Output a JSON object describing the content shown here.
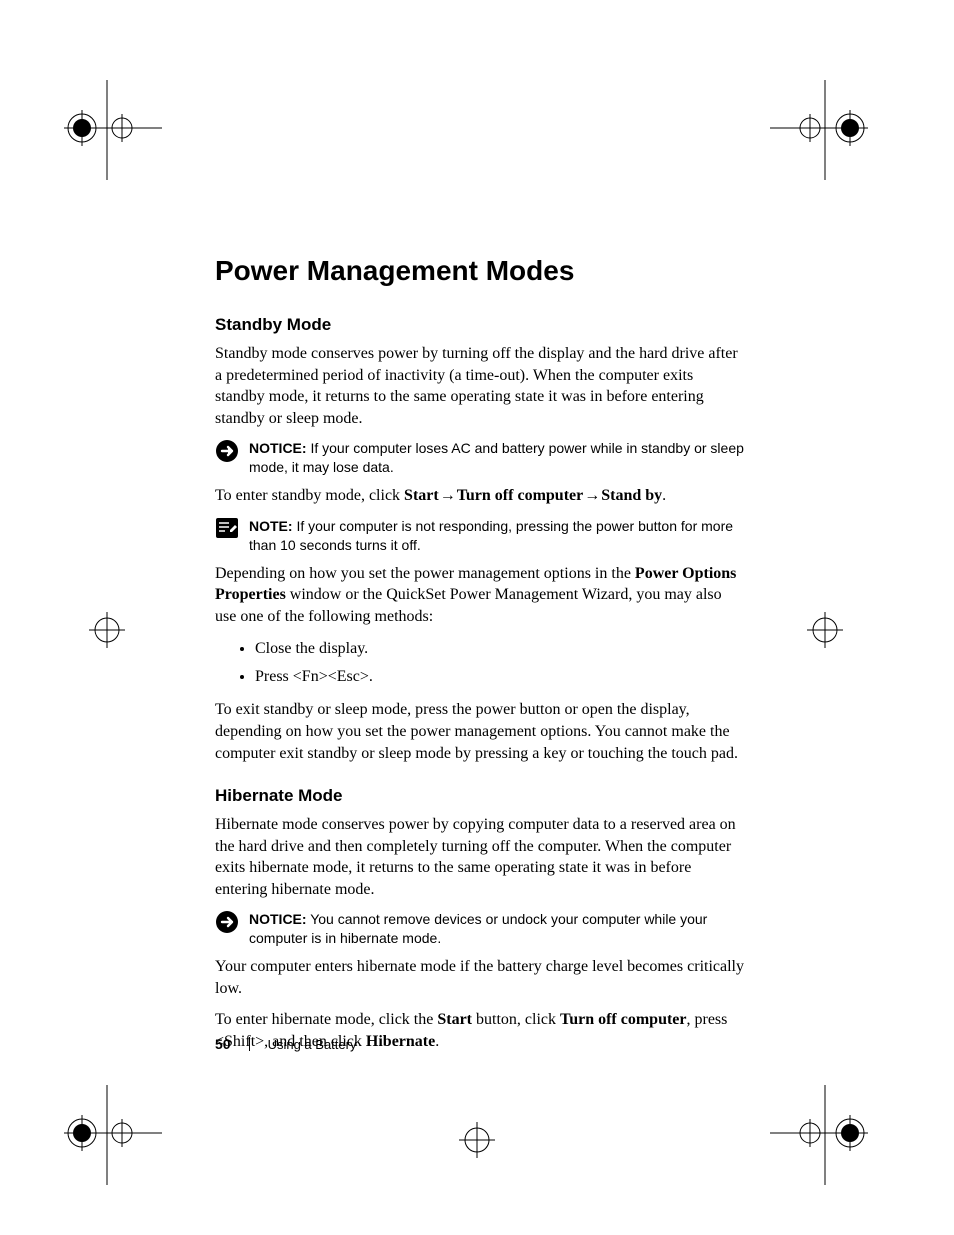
{
  "title": "Power Management Modes",
  "sections": {
    "standby": {
      "heading": "Standby Mode",
      "p1": "Standby mode conserves power by turning off the display and the hard drive after a predetermined period of inactivity (a time-out). When the computer exits standby mode, it returns to the same operating state it was in before entering standby or sleep mode.",
      "notice1_label": "NOTICE:",
      "notice1": " If your computer loses AC and battery power while in standby or sleep mode, it may lose data.",
      "enter_pre": "To enter standby mode, click ",
      "enter_b1": "Start",
      "enter_b2": "Turn off computer",
      "enter_b3": "Stand by",
      "note_label": "NOTE:",
      "note": " If your computer is not responding, pressing the power button for more than 10 seconds turns it off.",
      "p3_pre": "Depending on how you set the power management options in the ",
      "p3_b1": "Power Options Properties",
      "p3_post": " window or the QuickSet Power Management Wizard, you may also use one of the following methods:",
      "li1": "Close the display.",
      "li2": "Press <Fn><Esc>.",
      "p4": "To exit standby or sleep mode, press the power button or open the display, depending on how you set the power management options. You cannot make the computer exit standby or sleep mode by pressing a key or touching the touch pad."
    },
    "hibernate": {
      "heading": "Hibernate Mode",
      "p1": "Hibernate mode conserves power by copying computer data to a reserved area on the hard drive and then completely turning off the computer. When the computer exits hibernate mode, it returns to the same operating state it was in before entering hibernate mode.",
      "notice_label": "NOTICE:",
      "notice": " You cannot remove devices or undock your computer while your computer is in hibernate mode.",
      "p2": "Your computer enters hibernate mode if the battery charge level becomes critically low.",
      "p3_pre": "To enter hibernate mode, click the ",
      "p3_b1": "Start",
      "p3_mid1": " button, click ",
      "p3_b2": "Turn off computer",
      "p3_mid2": ", press <Shift>, and then click ",
      "p3_b3": "Hibernate",
      "p3_post": "."
    }
  },
  "footer": {
    "page": "50",
    "section": "Using a Battery"
  },
  "glyphs": {
    "arrow": "→"
  }
}
